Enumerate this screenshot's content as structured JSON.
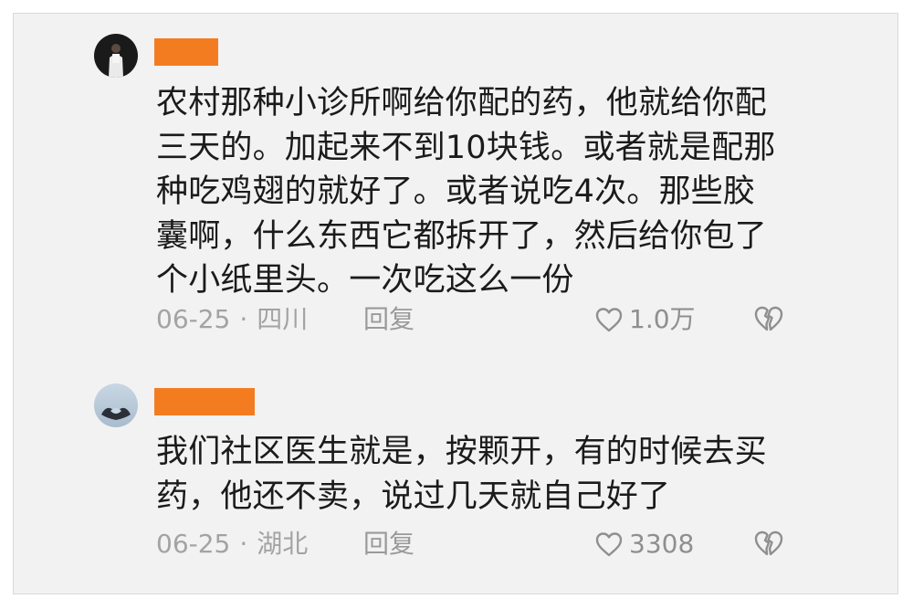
{
  "comments": [
    {
      "text": "农村那种小诊所啊给你配的药，他就给你配\n三天的。加起来不到10块钱。或者就是配那\n种吃鸡翅的就好了。或者说吃4次。那些胶\n囊啊，什么东西它都拆开了，然后给你包了\n个小纸里头。一次吃这么一份",
      "date": "06-25",
      "separator": "·",
      "location": "四川",
      "reply_label": "回复",
      "likes": "1.0万"
    },
    {
      "text": "我们社区医生就是，按颗开，有的时候去买\n药，他还不卖，说过几天就自己好了",
      "date": "06-25",
      "separator": "·",
      "location": "湖北",
      "reply_label": "回复",
      "likes": "3308"
    }
  ],
  "colors": {
    "name_redaction": "#f47c20",
    "meta_text": "#a3a3a3",
    "body_text": "#1b1b1b",
    "background": "#f2f2f2"
  },
  "icons": {
    "like": "heart-outline-icon",
    "dislike": "broken-heart-icon"
  }
}
